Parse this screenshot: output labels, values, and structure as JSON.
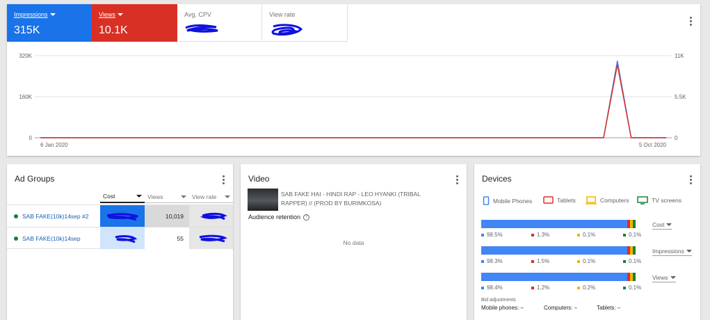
{
  "top": {
    "metrics": [
      {
        "label": "Impressions",
        "value": "315K"
      },
      {
        "label": "Views",
        "value": "10.1K"
      },
      {
        "label": "Avg. CPV",
        "value": ""
      },
      {
        "label": "View rate",
        "value": ""
      }
    ]
  },
  "chart_data": {
    "type": "line",
    "x_start_label": "6 Jan 2020",
    "x_end_label": "5 Oct 2020",
    "left_axis_ticks": [
      "320K",
      "160K",
      "0"
    ],
    "right_axis_ticks": [
      "11K",
      "5.5K",
      "0"
    ],
    "ylim_left": [
      0,
      320000
    ],
    "ylim_right": [
      0,
      11000
    ],
    "grid": true,
    "series": [
      {
        "name": "Impressions",
        "color": "#4285f4",
        "axis": "left",
        "points": [
          [
            0,
            0
          ],
          [
            0.9,
            0
          ],
          [
            0.922,
            300000
          ],
          [
            0.944,
            0
          ],
          [
            1,
            0
          ]
        ]
      },
      {
        "name": "Views",
        "color": "#d93025",
        "axis": "right",
        "points": [
          [
            0,
            0
          ],
          [
            0.9,
            0
          ],
          [
            0.922,
            9800
          ],
          [
            0.944,
            0
          ],
          [
            1,
            0
          ]
        ]
      }
    ]
  },
  "adgroups": {
    "title": "Ad Groups",
    "columns": [
      "Cost",
      "Views",
      "View rate"
    ],
    "rows": [
      {
        "name": "SAB FAKE(10k)14sep #2",
        "views": "10,019"
      },
      {
        "name": "SAB FAKE(10k)14sep",
        "views": "55"
      }
    ]
  },
  "video": {
    "title": "Video",
    "video_title": "SAB FAKE HAI - HINDI RAP - LEO HYANKI (TRIBAL RAPPER) // (PROD BY BURIMKOSA)",
    "retention_label": "Audience retention",
    "no_data": "No data"
  },
  "devices": {
    "title": "Devices",
    "legend": [
      {
        "label": "Mobile Phones",
        "color": "#4285f4"
      },
      {
        "label": "Tablets",
        "color": "#d93025"
      },
      {
        "label": "Computers",
        "color": "#f4b400"
      },
      {
        "label": "TV screens",
        "color": "#188038"
      }
    ],
    "rows": [
      {
        "metric": "Cost",
        "shares": [
          98.5,
          1.3,
          0.1,
          0.1
        ],
        "labels": [
          "98.5%",
          "1.3%",
          "0.1%",
          "0.1%"
        ]
      },
      {
        "metric": "Impressions",
        "shares": [
          98.3,
          1.5,
          0.1,
          0.1
        ],
        "labels": [
          "98.3%",
          "1.5%",
          "0.1%",
          "0.1%"
        ]
      },
      {
        "metric": "Views",
        "shares": [
          98.4,
          1.2,
          0.2,
          0.1
        ],
        "labels": [
          "98.4%",
          "1.2%",
          "0.2%",
          "0.1%"
        ]
      }
    ],
    "bid_label": "Bid adjustments",
    "bid": [
      {
        "text": "Mobile phones: –"
      },
      {
        "text": "Computers: –"
      },
      {
        "text": "Tablets: –"
      }
    ]
  }
}
